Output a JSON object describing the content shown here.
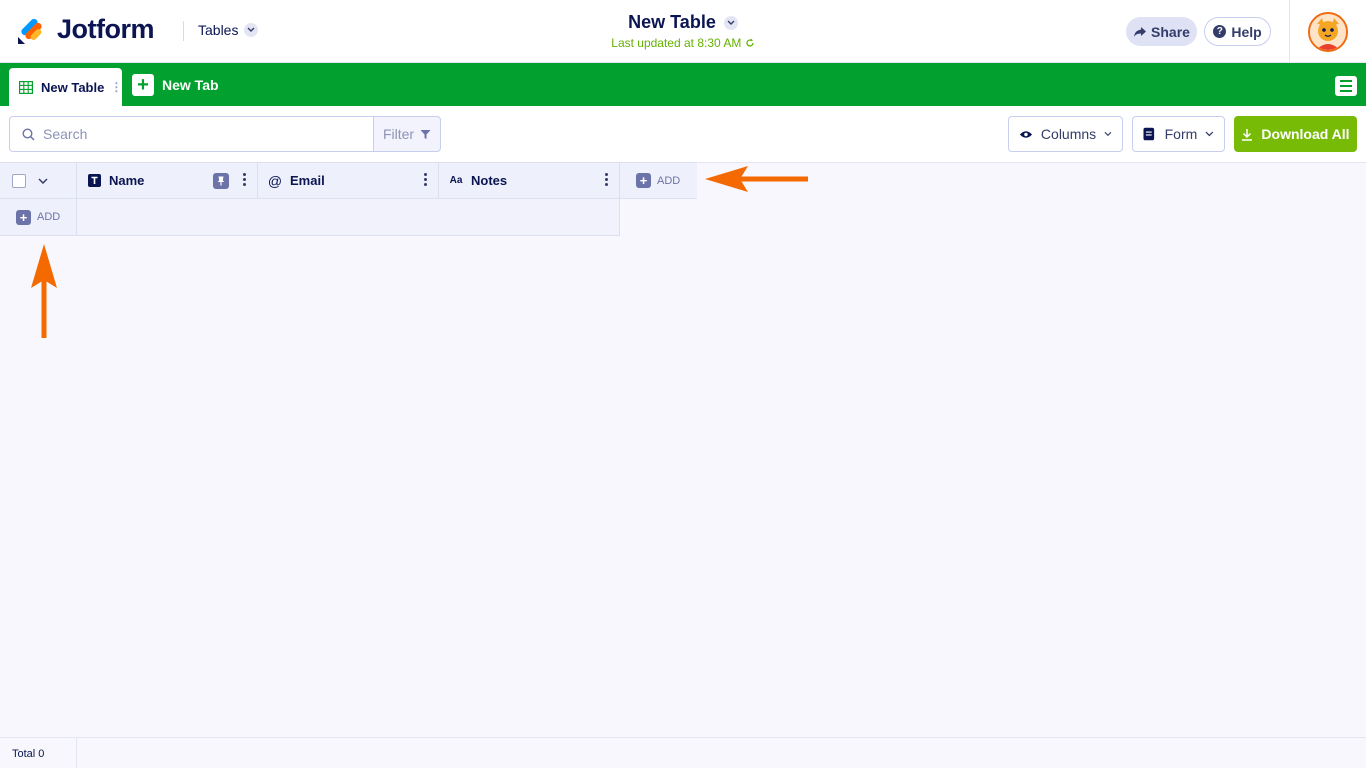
{
  "header": {
    "brand": "Jotform",
    "section": "Tables",
    "title": "New Table",
    "last_updated": "Last updated at 8:30 AM",
    "share_label": "Share",
    "help_label": "Help"
  },
  "tabs": {
    "active_label": "New Table",
    "new_tab_label": "New Tab"
  },
  "toolbar": {
    "search_placeholder": "Search",
    "filter_label": "Filter",
    "columns_label": "Columns",
    "form_label": "Form",
    "download_label": "Download All"
  },
  "grid": {
    "columns": [
      {
        "label": "Name",
        "type_icon": "text-type-icon"
      },
      {
        "label": "Email",
        "type_icon": "at-sign-icon"
      },
      {
        "label": "Notes",
        "type_icon": "long-text-icon"
      }
    ],
    "add_column_label": "ADD",
    "add_row_label": "ADD"
  },
  "footer": {
    "total_label": "Total 0"
  },
  "colors": {
    "brand_green": "#02a02e",
    "download_green": "#78bb07",
    "annotation_orange": "#f56a00",
    "navy": "#0a1551"
  }
}
